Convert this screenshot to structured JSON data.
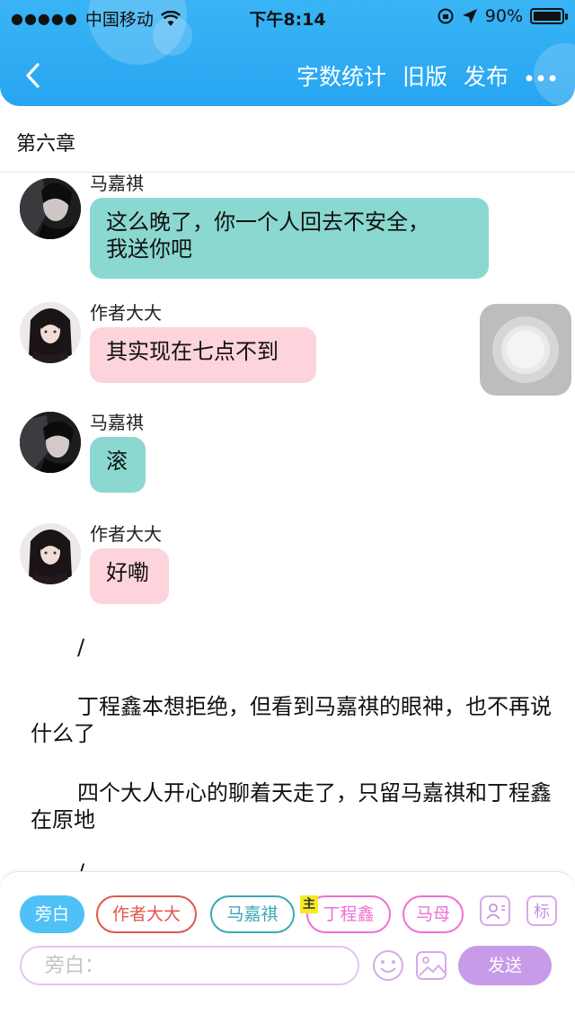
{
  "status_bar": {
    "carrier": "中国移动",
    "time": "下午8:14",
    "battery": "90%",
    "battery_level": 0.9
  },
  "nav": {
    "back_icon": "chevron-left-icon",
    "word_count": "字数统计",
    "old_version": "旧版",
    "publish": "发布",
    "more_icon": "more-icon"
  },
  "chapter": {
    "title": "第六章"
  },
  "messages": [
    {
      "sender": "马嘉祺",
      "text_lines": [
        "这么晚了，你一个人回去不安全，",
        "我送你吧"
      ],
      "color": "#8ad8d0"
    },
    {
      "sender": "作者大大",
      "text_lines": [
        "其实现在七点不到"
      ],
      "color": "#fdd3dc"
    },
    {
      "sender": "马嘉祺",
      "text_lines": [
        "滚"
      ],
      "color": "#8ad8d0"
    },
    {
      "sender": "作者大大",
      "text_lines": [
        "好嘞"
      ],
      "color": "#fdd3dc"
    }
  ],
  "narration": [
    "/",
    "丁程鑫本想拒绝，但看到马嘉祺的眼神，也不再说什么了",
    "四个大人开心的聊着天走了，只留马嘉祺和丁程鑫在原地",
    "/"
  ],
  "roles": [
    {
      "label": "旁白",
      "active": true
    },
    {
      "label": "作者大大",
      "active": false
    },
    {
      "label": "马嘉祺",
      "active": false
    },
    {
      "label": "丁程鑫",
      "active": false,
      "tag": "主"
    },
    {
      "label": "马母",
      "active": false
    }
  ],
  "tools": {
    "role_manage_icon": "person-card-icon",
    "mark_label": "标"
  },
  "composer": {
    "placeholder": "旁白：",
    "emoji_icon": "smiley-icon",
    "image_icon": "image-icon",
    "send_label": "发送"
  }
}
